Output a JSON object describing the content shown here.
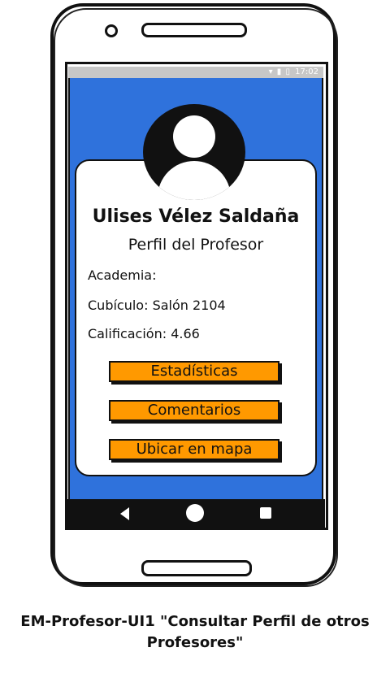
{
  "status_bar": {
    "time": "17:02",
    "icons": "wifi-signal-battery"
  },
  "profile": {
    "name": "Ulises Vélez Saldaña",
    "subtitle": "Perfil del Profesor",
    "academy": "Academia:",
    "cubicle": "Cubículo: Salón 2104",
    "rating": "Calificación: 4.66"
  },
  "buttons": {
    "stats": "Estadísticas",
    "comments": "Comentarios",
    "map": "Ubicar en mapa"
  },
  "caption": "EM-Profesor-UI1 \"Consultar Perfil de otros Profesores\"",
  "colors": {
    "screen_bg": "#2f72dc",
    "button_bg": "#ff9900"
  }
}
